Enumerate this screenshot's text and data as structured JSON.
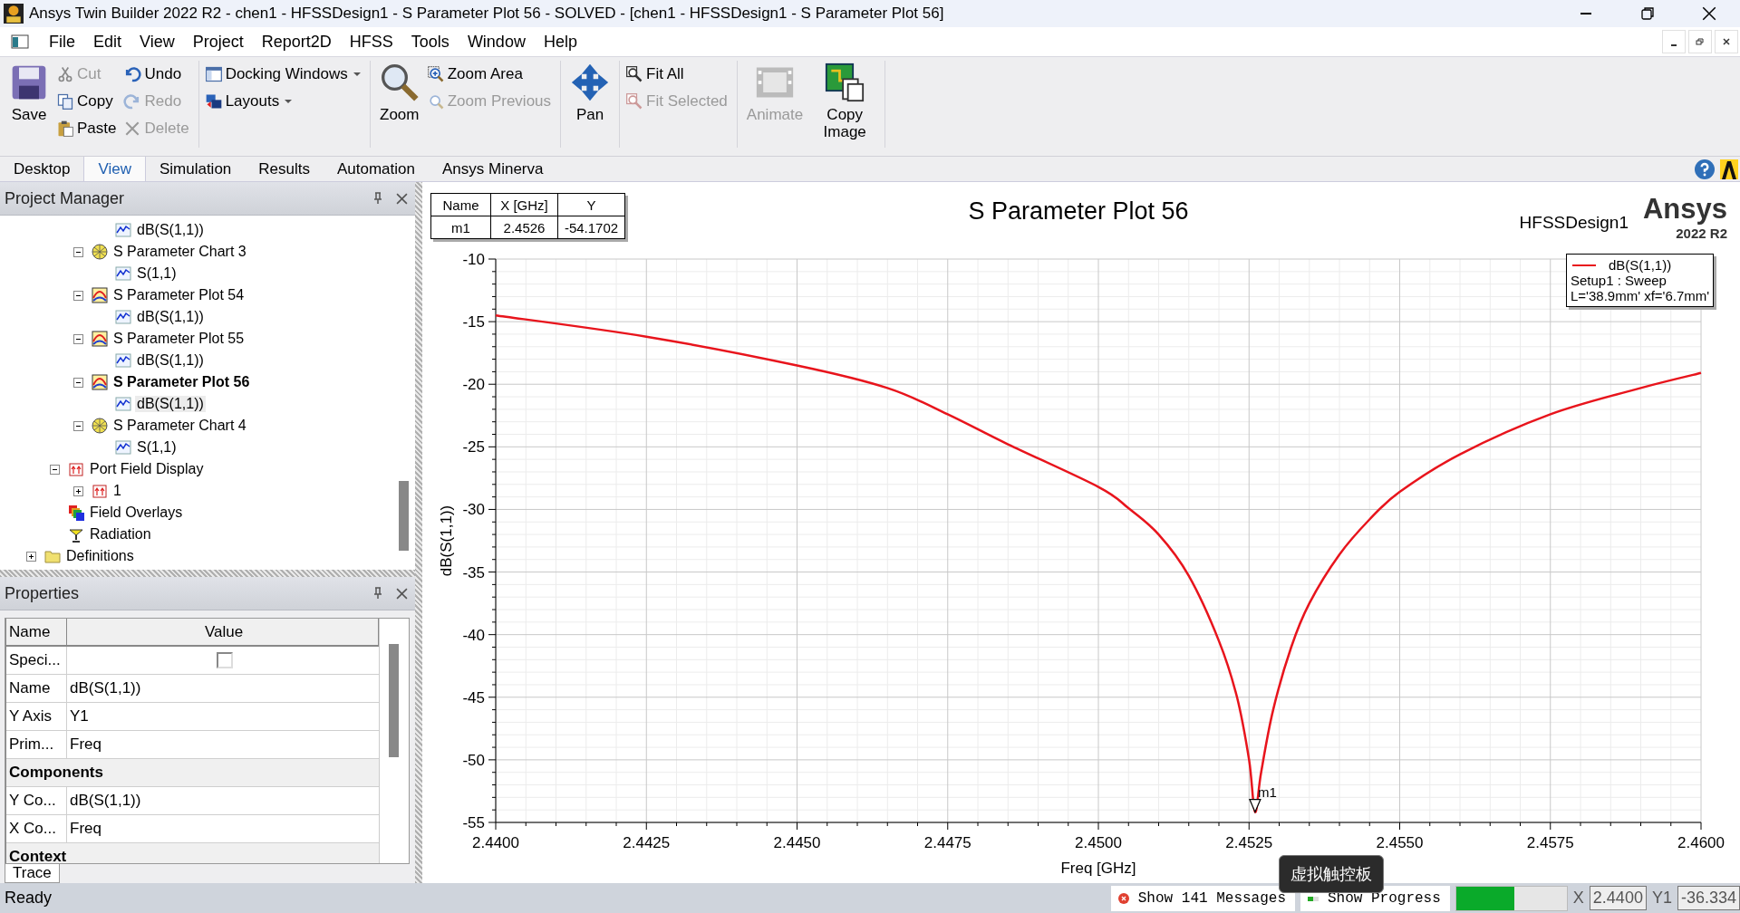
{
  "window": {
    "title": "Ansys Twin Builder 2022 R2 - chen1 - HFSSDesign1 - S Parameter Plot 56 - SOLVED - [chen1 - HFSSDesign1 - S Parameter Plot 56]"
  },
  "menu": [
    "File",
    "Edit",
    "View",
    "Project",
    "Report2D",
    "HFSS",
    "Tools",
    "Window",
    "Help"
  ],
  "ribbon": {
    "groups": [
      {
        "items": [
          {
            "label": "Save",
            "kind": "large",
            "disabled": false
          },
          {
            "label": "Cut",
            "kind": "small",
            "disabled": true
          },
          {
            "label": "Copy",
            "kind": "small",
            "disabled": false
          },
          {
            "label": "Paste",
            "kind": "small",
            "disabled": false
          },
          {
            "label": "Undo",
            "kind": "small",
            "disabled": false
          },
          {
            "label": "Redo",
            "kind": "small",
            "disabled": true
          },
          {
            "label": "Delete",
            "kind": "small",
            "disabled": true
          }
        ]
      },
      {
        "items": [
          {
            "label": "Docking Windows",
            "kind": "small",
            "disabled": false,
            "dropdown": true
          },
          {
            "label": "Layouts",
            "kind": "small",
            "disabled": false,
            "dropdown": true
          }
        ]
      },
      {
        "items": [
          {
            "label": "Zoom",
            "kind": "large",
            "disabled": false
          },
          {
            "label": "Zoom Area",
            "kind": "small",
            "disabled": false
          },
          {
            "label": "Zoom Previous",
            "kind": "small",
            "disabled": true
          }
        ]
      },
      {
        "items": [
          {
            "label": "Pan",
            "kind": "large",
            "disabled": false
          }
        ]
      },
      {
        "items": [
          {
            "label": "Fit All",
            "kind": "small",
            "disabled": false
          },
          {
            "label": "Fit Selected",
            "kind": "small",
            "disabled": true
          }
        ]
      },
      {
        "items": [
          {
            "label": "Animate",
            "kind": "large",
            "disabled": true
          },
          {
            "label": "Copy Image",
            "kind": "large",
            "disabled": false
          }
        ]
      }
    ]
  },
  "ribbon_tabs": [
    {
      "label": "Desktop",
      "selected": false
    },
    {
      "label": "View",
      "selected": true
    },
    {
      "label": "Simulation",
      "selected": false
    },
    {
      "label": "Results",
      "selected": false
    },
    {
      "label": "Automation",
      "selected": false
    },
    {
      "label": "Ansys Minerva",
      "selected": false
    }
  ],
  "project_manager": {
    "title": "Project Manager",
    "tree": [
      {
        "children": [
          {
            "children": [
              {
                "children": [
                  {
                    "children": [
                      {
                        "label": "dB(S(1,1))",
                        "kind": "trace",
                        "selected": false,
                        "active": false
                      }
                    ]
                  },
                  {
                    "label": "S Parameter Chart 3",
                    "kind": "smith",
                    "expanded": true,
                    "selected": false,
                    "active": false,
                    "children": [
                      {
                        "label": "S(1,1)",
                        "kind": "trace",
                        "selected": false,
                        "active": false
                      }
                    ]
                  },
                  {
                    "label": "S Parameter Plot 54",
                    "kind": "rect",
                    "expanded": true,
                    "selected": false,
                    "active": false,
                    "children": [
                      {
                        "label": "dB(S(1,1))",
                        "kind": "trace",
                        "selected": false,
                        "active": false
                      }
                    ]
                  },
                  {
                    "label": "S Parameter Plot 55",
                    "kind": "rect",
                    "expanded": true,
                    "selected": false,
                    "active": false,
                    "children": [
                      {
                        "label": "dB(S(1,1))",
                        "kind": "trace",
                        "selected": false,
                        "active": false
                      }
                    ]
                  },
                  {
                    "label": "S Parameter Plot 56",
                    "kind": "rect",
                    "expanded": true,
                    "selected": false,
                    "active": true,
                    "children": [
                      {
                        "label": "dB(S(1,1))",
                        "kind": "trace",
                        "selected": true,
                        "active": false
                      }
                    ]
                  },
                  {
                    "label": "S Parameter Chart 4",
                    "kind": "smith",
                    "expanded": true,
                    "selected": false,
                    "active": false,
                    "children": [
                      {
                        "label": "S(1,1)",
                        "kind": "trace",
                        "selected": false,
                        "active": false
                      }
                    ]
                  }
                ]
              },
              {
                "label": "Port Field Display",
                "kind": "port",
                "expanded": true,
                "selected": false,
                "active": false,
                "children": [
                  {
                    "label": "1",
                    "kind": "port",
                    "expanded": false,
                    "selected": false,
                    "active": false
                  }
                ]
              },
              {
                "label": "Field Overlays",
                "kind": "overlay",
                "selected": false,
                "active": false
              },
              {
                "label": "Radiation",
                "kind": "radiation",
                "selected": false,
                "active": false
              }
            ]
          },
          {
            "label": "Definitions",
            "kind": "folder",
            "expanded": false,
            "selected": false,
            "active": false
          }
        ]
      }
    ]
  },
  "properties": {
    "title": "Properties",
    "columns": [
      "Name",
      "Value"
    ],
    "rows": [
      {
        "kind": "check",
        "name": "Speci...",
        "checked": false
      },
      {
        "kind": "prop",
        "name": "Name",
        "value": "dB(S(1,1))"
      },
      {
        "kind": "prop",
        "name": "Y Axis",
        "value": "Y1"
      },
      {
        "kind": "prop",
        "name": "Prim...",
        "value": "Freq"
      },
      {
        "kind": "section",
        "name": "Components"
      },
      {
        "kind": "prop",
        "name": "Y Co...",
        "value": "dB(S(1,1))"
      },
      {
        "kind": "prop",
        "name": "X Co...",
        "value": "Freq"
      },
      {
        "kind": "section",
        "name": "Context"
      }
    ],
    "tabs": [
      {
        "label": "Trace",
        "selected": true
      }
    ]
  },
  "plot": {
    "design": "HFSSDesign1",
    "brand": "Ansys",
    "version": "2022 R2",
    "marker_table": {
      "columns": [
        "Name",
        "X [GHz]",
        "Y"
      ],
      "rows": [
        [
          "m1",
          "2.4526",
          "-54.1702"
        ]
      ]
    },
    "legend": {
      "lines": [
        "Setup1 : Sweep",
        "L='38.9mm' xf='6.7mm'"
      ]
    },
    "chart_data": {
      "type": "line",
      "title": "S Parameter Plot 56",
      "xlabel": "Freq [GHz]",
      "ylabel": "dB(S(1,1))",
      "x": [
        2.44,
        2.4425,
        2.445,
        2.4465,
        2.4475,
        2.4485,
        2.45,
        2.4505,
        2.451,
        2.4515,
        2.452,
        2.4523,
        2.4525,
        2.4526,
        2.4527,
        2.4529,
        2.4532,
        2.4535,
        2.454,
        2.4545,
        2.455,
        2.456,
        2.4575,
        2.459,
        2.46
      ],
      "series": [
        {
          "name": "dB(S(1,1))",
          "color": "#e8141c",
          "values": [
            -14.5,
            -16.2,
            -18.5,
            -20.3,
            -22.4,
            -24.8,
            -28.2,
            -29.9,
            -32,
            -35.3,
            -40.5,
            -45,
            -50,
            -54.17,
            -51,
            -46,
            -41,
            -37.5,
            -33.6,
            -30.8,
            -28.6,
            -25.6,
            -22.4,
            -20.3,
            -19.1
          ]
        }
      ],
      "xlim": [
        2.44,
        2.46
      ],
      "ylim": [
        -55,
        -10
      ],
      "xticks": [
        {
          "value": 2.44,
          "label": "2.4400"
        },
        {
          "value": 2.4425,
          "label": "2.4425"
        },
        {
          "value": 2.445,
          "label": "2.4450"
        },
        {
          "value": 2.4475,
          "label": "2.4475"
        },
        {
          "value": 2.45,
          "label": "2.4500"
        },
        {
          "value": 2.4525,
          "label": "2.4525"
        },
        {
          "value": 2.455,
          "label": "2.4550"
        },
        {
          "value": 2.4575,
          "label": "2.4575"
        },
        {
          "value": 2.46,
          "label": "2.4600"
        }
      ],
      "yticks": [
        -55,
        -50,
        -45,
        -40,
        -35,
        -30,
        -25,
        -20,
        -15,
        -10
      ],
      "grid": true,
      "annotations": [
        {
          "text": "m1",
          "x": 2.4526,
          "y": -54.17
        }
      ]
    }
  },
  "tooltip": "虚拟触控板",
  "status_bar": {
    "text": "Ready",
    "messages_button": "Show 141 Messages",
    "progress_button": "Show Progress",
    "progress": {
      "level": 0.53
    },
    "x_label": "X",
    "x_value": "2.4400",
    "y_label": "Y1",
    "y_value": "-36.334"
  }
}
